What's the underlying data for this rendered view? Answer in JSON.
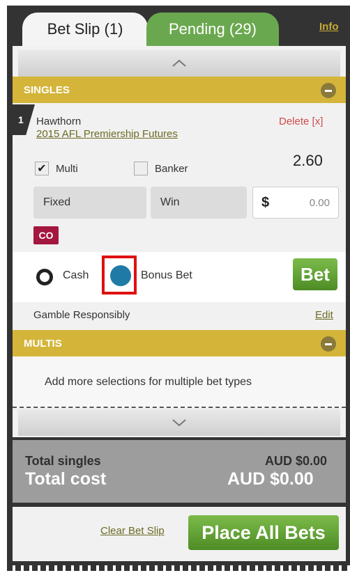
{
  "tabs": [
    {
      "label": "Bet Slip (1)"
    },
    {
      "label": "Pending (29)"
    }
  ],
  "info_link": "Info",
  "singles": {
    "title": "SINGLES",
    "selection_number": "1",
    "runner": "Hawthorn",
    "event": "2015 AFL Premiership Futures",
    "delete_label": "Delete [x]",
    "odds": "2.60",
    "multi_label": "Multi",
    "multi_checked": true,
    "banker_label": "Banker",
    "banker_checked": false,
    "bet_type": "Fixed",
    "market": "Win",
    "currency_symbol": "$",
    "stake": "0.00",
    "code_badge": "CO",
    "cash_label": "Cash",
    "bonus_label": "Bonus Bet",
    "selected_option": "Bonus Bet",
    "bet_button_label": "Bet",
    "gamble_text": "Gamble Responsibly",
    "edit_label": "Edit"
  },
  "multis": {
    "title": "MULTIS",
    "message": "Add more selections for multiple bet types"
  },
  "totals": {
    "singles_label": "Total singles",
    "singles_value": "AUD $0.00",
    "cost_label": "Total cost",
    "cost_value": "AUD $0.00"
  },
  "footer": {
    "clear_label": "Clear Bet Slip",
    "place_all_label": "Place All Bets"
  },
  "colors": {
    "header_gold": "#d4b53a",
    "tab_green": "#6aa84f",
    "button_green": "#4e8c25",
    "bonus_radio": "#1f7aa6",
    "highlight_red": "#e01010",
    "co_badge": "#a4173f"
  }
}
